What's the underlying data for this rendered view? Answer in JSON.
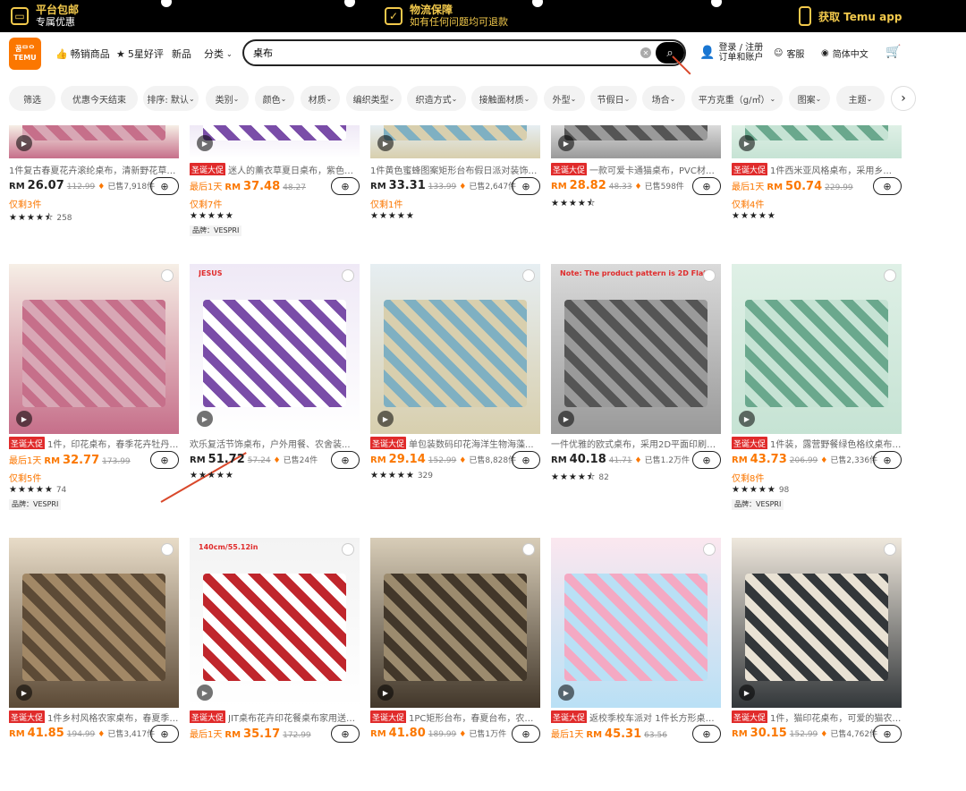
{
  "topbar": {
    "item1": {
      "title": "平台包邮",
      "sub": "专属优惠"
    },
    "item2": {
      "title": "物流保障",
      "sub": "如有任何问题均可退款"
    },
    "item3": {
      "title": "获取 Temu app"
    }
  },
  "header": {
    "logo_line1": "꿈ᄆᄋ",
    "logo_line2": "TEMU",
    "nav": [
      "畅销商品",
      "5星好评",
      "新品",
      "分类"
    ],
    "search": {
      "value": "桌布",
      "placeholder": ""
    },
    "login_line1": "登录 / 注册",
    "login_line2": "订单和账户",
    "support": "客服",
    "language": "简体中文"
  },
  "filters": [
    "筛选",
    "优惠今天结束",
    "排序: 默认",
    "类别",
    "颜色",
    "材质",
    "编织类型",
    "织造方式",
    "接触面材质",
    "外型",
    "节假日",
    "场合",
    "平方克重（g/㎡）",
    "图案",
    "主题"
  ],
  "currency": "RM",
  "row1": [
    {
      "title": "1件复古春夏花卉滚纶桌布，清新野花草地...",
      "badge": "",
      "prefix": "",
      "price": "26.07",
      "orig": "112.99",
      "sold": "已售7,918件",
      "left": "仅剩3件",
      "rating": "★★★★⯪",
      "count": "258",
      "brand": ""
    },
    {
      "title": "迷人的薰衣草夏日桌布，紫色花...",
      "badge": "圣诞大促",
      "prefix": "最后1天",
      "price": "37.48",
      "orig": "48.27",
      "sold": "",
      "left": "仅剩7件",
      "rating": "★★★★★",
      "count": "",
      "brand": "品牌：VESPRI"
    },
    {
      "title": "1件黄色蜜蜂图案矩形台布假日派对装饰可...",
      "badge": "",
      "prefix": "",
      "price": "33.31",
      "orig": "133.99",
      "sold": "已售2,647件",
      "left": "仅剩1件",
      "rating": "★★★★★",
      "count": "",
      "brand": ""
    },
    {
      "title": "一款可爱卡通猫桌布，PVC材质...",
      "badge": "圣诞大促",
      "prefix": "",
      "price": "28.82",
      "orig": "48.33",
      "sold": "已售598件",
      "left": "",
      "rating": "★★★★⯪",
      "count": "",
      "brand": ""
    },
    {
      "title": "1件西米亚风格桌布，采用乡...",
      "badge": "圣诞大促",
      "prefix": "最后1天",
      "price": "50.74",
      "orig": "229.99",
      "sold": "",
      "left": "仅剩4件",
      "rating": "★★★★★",
      "count": "",
      "brand": ""
    }
  ],
  "row2": [
    {
      "title": "1件，印花桌布，春季花卉牡丹蝴...",
      "badge": "圣诞大促",
      "prefix": "最后1天",
      "price": "32.77",
      "orig": "173.99",
      "sold": "",
      "left": "仅剩5件",
      "rating": "★★★★★",
      "count": "74",
      "brand": "品牌：VESPRI",
      "overlay": ""
    },
    {
      "title": "欢乐复活节饰桌布，户外用餐、农舍装...",
      "badge": "",
      "prefix": "",
      "price": "51.72",
      "orig": "57.24",
      "sold": "已售24件",
      "left": "",
      "rating": "★★★★★",
      "count": "",
      "brand": "",
      "overlay": "JESUS"
    },
    {
      "title": "单包装数码印花海洋生物海藻...",
      "badge": "圣诞大促",
      "prefix": "",
      "price": "29.14",
      "orig": "152.99",
      "sold": "已售8,828件",
      "left": "",
      "rating": "★★★★★",
      "count": "329",
      "brand": "",
      "overlay": ""
    },
    {
      "title": "一件优雅的欧式桌布，采用2D平面印刷和...",
      "badge": "",
      "prefix": "",
      "price": "40.18",
      "orig": "41.71",
      "sold": "已售1.2万件",
      "left": "",
      "rating": "★★★★⯪",
      "count": "82",
      "brand": "",
      "overlay": "Note: The product pattern is 2D Flat Printing"
    },
    {
      "title": "1件装，露营野餐绿色格纹桌布，...",
      "badge": "圣诞大促",
      "prefix": "",
      "price": "43.73",
      "orig": "206.99",
      "sold": "已售2,336件",
      "left": "仅剩8件",
      "rating": "★★★★★",
      "count": "98",
      "brand": "品牌：VESPRI",
      "overlay": ""
    }
  ],
  "row3": [
    {
      "title": "1件乡村风格农家桌布，春夏季画...",
      "badge": "圣诞大促",
      "prefix": "",
      "price": "41.85",
      "orig": "194.99",
      "sold": "已售3,417件",
      "left": "",
      "overlay": ""
    },
    {
      "title": "JIT桌布花卉印花餐桌布家用送礼...",
      "badge": "圣诞大促",
      "prefix": "最后1天",
      "price": "35.17",
      "orig": "172.99",
      "sold": "",
      "left": "",
      "overlay": "140cm/55.12in"
    },
    {
      "title": "1PC矩形台布，春夏台布，农家复...",
      "badge": "圣诞大促",
      "prefix": "",
      "price": "41.80",
      "orig": "189.99",
      "sold": "已售1万件",
      "left": "",
      "overlay": ""
    },
    {
      "title": "返校季校车派对 1件长方形桌布...",
      "badge": "圣诞大促",
      "prefix": "最后1天",
      "price": "45.31",
      "orig": "63.56",
      "sold": "",
      "left": "",
      "overlay": ""
    },
    {
      "title": "1件，猫印花桌布，可爱的猫农舍...",
      "badge": "圣诞大促",
      "prefix": "",
      "price": "30.15",
      "orig": "152.99",
      "sold": "已售4,762件",
      "left": "",
      "overlay": ""
    }
  ],
  "colors": {
    "brand": "#fb7701",
    "promo": "#e02b2b",
    "annotation": "#d9482b"
  }
}
